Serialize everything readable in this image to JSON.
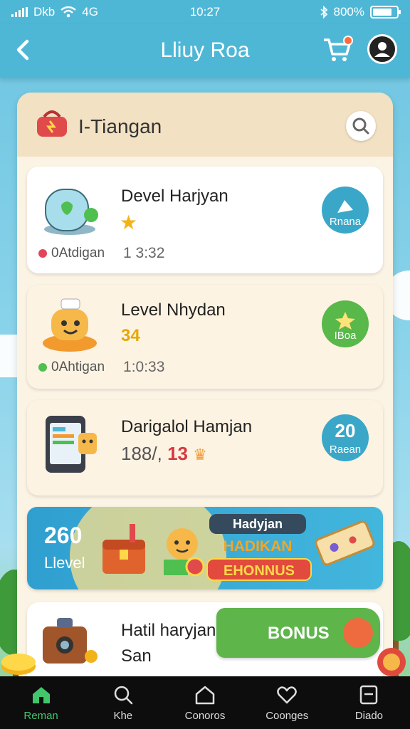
{
  "status_bar": {
    "carrier": "Dkb",
    "network": "4G",
    "time": "10:27",
    "battery": "800%",
    "battery_level": 0.8
  },
  "app_bar": {
    "title": "Lliuy Roa",
    "back_icon": "chevron-left-icon",
    "cart_icon": "cart-icon",
    "profile_icon": "profile-icon"
  },
  "panel": {
    "title": "I-Tiangan",
    "search_icon": "search-icon"
  },
  "cards": [
    {
      "title": "Devel Harjyan",
      "meta_label": "0Atdigan",
      "meta_dot_color": "#e0455c",
      "time": "1 3:32",
      "badge_label": "Rnana",
      "badge_color": "#3aa7c8"
    },
    {
      "title": "Level Nhydan",
      "rating": "34",
      "meta_label": "0Ahtigan",
      "meta_dot_color": "#4fbf4f",
      "time": "1:0:33",
      "badge_label": "IBoa",
      "badge_color": "#58b84a"
    },
    {
      "title": "Darigalol Hamjan",
      "progress_gray": "188/,",
      "progress_red": "13",
      "badge_value": "20",
      "badge_label": "Raean",
      "badge_color": "#3aa7c8"
    },
    {
      "title_line1": "Hatil haryjan",
      "title_line2": "San"
    }
  ],
  "banner": {
    "value": "260",
    "label": "Llevel",
    "tag_top": "Hadyjan",
    "tag_middle": "HADIKAN",
    "tag_bottom": "EHONNUS"
  },
  "bonus_button": {
    "label": "BONUS"
  },
  "nav": {
    "items": [
      {
        "label": "Reman",
        "icon": "home-icon",
        "active": true
      },
      {
        "label": "Khe",
        "icon": "search-icon",
        "active": false
      },
      {
        "label": "Conoros",
        "icon": "house-outline-icon",
        "active": false
      },
      {
        "label": "Coonges",
        "icon": "heart-icon",
        "active": false
      },
      {
        "label": "Diado",
        "icon": "square-icon",
        "active": false
      }
    ]
  },
  "colors": {
    "accent": "#4fb7d6",
    "nav_active": "#41c66b",
    "bonus_green": "#5eb54a"
  }
}
